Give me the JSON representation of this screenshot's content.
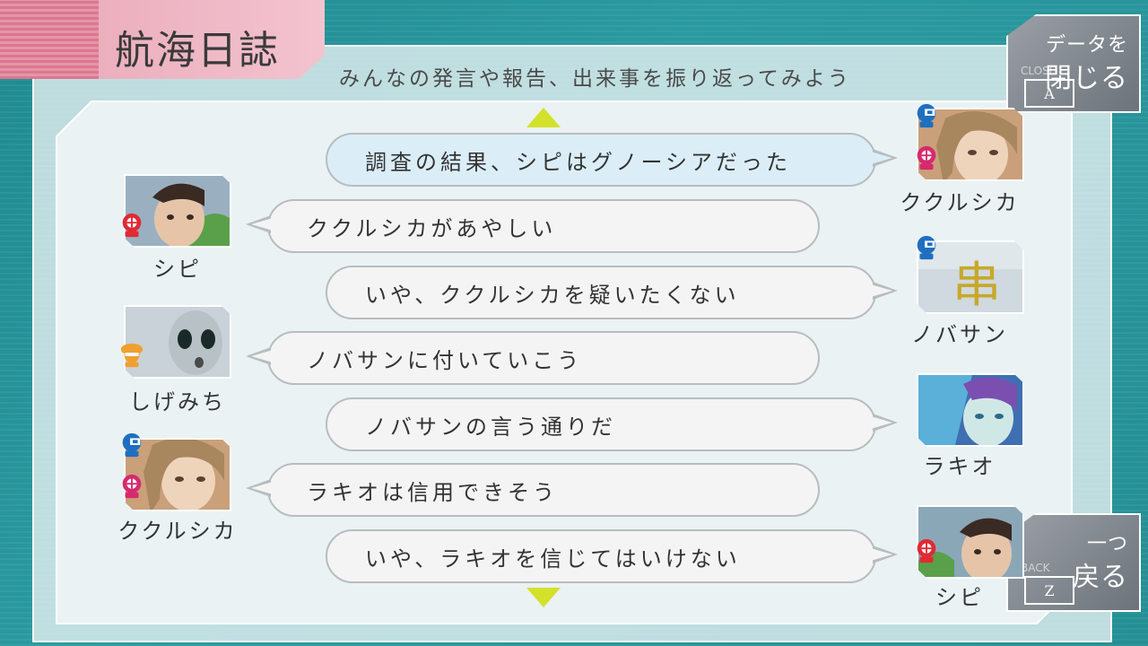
{
  "header": {
    "title": "航海日誌",
    "subtitle": "みんなの発言や報告、出来事を振り返ってみよう"
  },
  "buttons": {
    "close": {
      "line1": "データを",
      "line2": "閉じる",
      "key": "A",
      "key_label": "CLOSE"
    },
    "back": {
      "line1": "一つ",
      "line2": "戻る",
      "key": "Z",
      "key_label": "BACK"
    }
  },
  "entries": [
    {
      "text": "調査の結果、シピはグノーシアだった",
      "speaker": "ククルシカ",
      "side": "right",
      "highlight": true
    },
    {
      "text": "ククルシカがあやしい",
      "speaker": "シピ",
      "side": "left"
    },
    {
      "text": "いや、ククルシカを疑いたくない",
      "speaker": "ノバサン",
      "side": "right"
    },
    {
      "text": "ノバサンに付いていこう",
      "speaker": "しげみち",
      "side": "left"
    },
    {
      "text": "ノバサンの言う通りだ",
      "speaker": "ラキオ",
      "side": "right"
    },
    {
      "text": "ラキオは信用できそう",
      "speaker": "ククルシカ",
      "side": "left"
    },
    {
      "text": "いや、ラキオを信じてはいけない",
      "speaker": "シピ",
      "side": "right"
    }
  ],
  "colors": {
    "accent_arrow": "#d3e12a",
    "engineer_icon": "#1f6fc0",
    "gnosia_icon": "#d62a6e",
    "gnosia_red": "#e02a34",
    "guard_icon": "#f0a030"
  },
  "icons": [
    "scroll-up-icon",
    "scroll-down-icon",
    "engineer-role-icon",
    "gnosia-role-icon",
    "guard-role-icon"
  ]
}
